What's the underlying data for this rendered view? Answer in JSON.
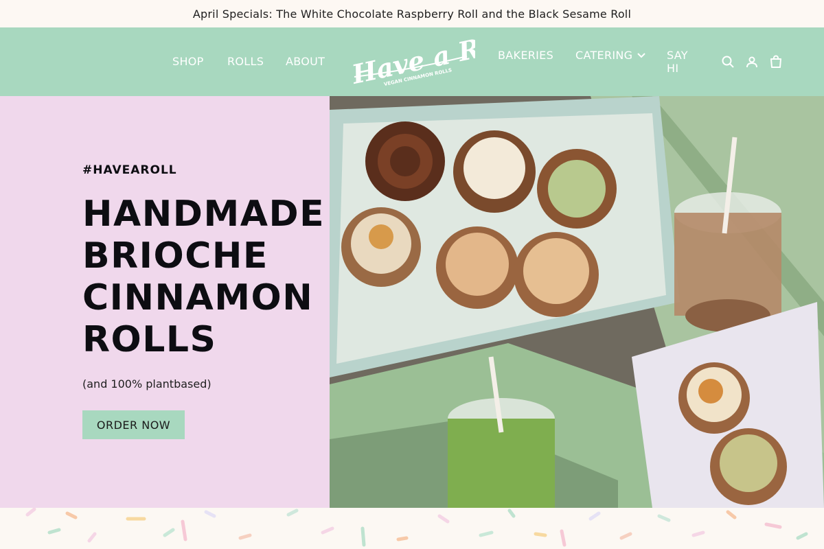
{
  "announcement": {
    "text": "April Specials: The White Chocolate Raspberry Roll and the Black Sesame Roll"
  },
  "header": {
    "nav_left": [
      "SHOP",
      "ROLLS",
      "ABOUT"
    ],
    "nav_right": {
      "bakeries": "BAKERIES",
      "catering": "CATERING",
      "say_hi": "SAY HI"
    },
    "logo": {
      "brand": "Have a Roll",
      "tagline": "VEGAN CINNAMON ROLLS"
    },
    "icons": [
      "search-icon",
      "account-icon",
      "cart-icon"
    ],
    "background_color": "#a8d8bf"
  },
  "hero": {
    "hashtag": "#HAVEAROLL",
    "title_lines": [
      "HANDMADE",
      "BRIOCHE",
      "CINNAMON",
      "ROLLS"
    ],
    "subtitle": "(and 100% plantbased)",
    "cta_label": "ORDER NOW",
    "background_color": "#f0d8ec",
    "image_alt": "Box of assorted vegan cinnamon rolls with iced coffee and iced matcha"
  },
  "colors": {
    "mint": "#a8d8bf",
    "pink": "#f0d8ec",
    "cream": "#fdf8f3",
    "ink": "#0d0d12"
  }
}
